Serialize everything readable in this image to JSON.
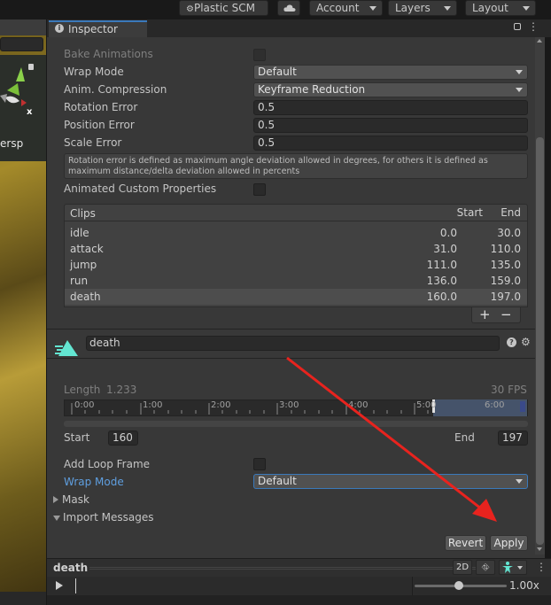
{
  "toolbar": {
    "plastic_scm": "Plastic SCM",
    "cloud_icon": "cloud-icon",
    "account": "Account",
    "layers": "Layers",
    "layout": "Layout"
  },
  "scene": {
    "persp": "ersp",
    "axis_x": "x"
  },
  "inspector": {
    "tab_label": "Inspector",
    "bake_animations": "Bake Animations",
    "wrap_mode_label": "Wrap Mode",
    "wrap_mode_value": "Default",
    "anim_compression_label": "Anim. Compression",
    "anim_compression_value": "Keyframe Reduction",
    "rotation_error_label": "Rotation Error",
    "rotation_error_value": "0.5",
    "position_error_label": "Position Error",
    "position_error_value": "0.5",
    "scale_error_label": "Scale Error",
    "scale_error_value": "0.5",
    "help_text": "Rotation error is defined as maximum angle deviation allowed in degrees, for others it is defined as maximum distance/delta deviation allowed in percents",
    "animated_custom_props": "Animated Custom Properties"
  },
  "clips": {
    "header": "Clips",
    "start_header": "Start",
    "end_header": "End",
    "rows": [
      {
        "name": "idle",
        "start": "0.0",
        "end": "30.0"
      },
      {
        "name": "attack",
        "start": "31.0",
        "end": "110.0"
      },
      {
        "name": "jump",
        "start": "111.0",
        "end": "135.0"
      },
      {
        "name": "run",
        "start": "136.0",
        "end": "159.0"
      },
      {
        "name": "death",
        "start": "160.0",
        "end": "197.0"
      }
    ],
    "add": "+",
    "remove": "−"
  },
  "clip_detail": {
    "name": "death",
    "length_label": "Length",
    "length_value": "1.233",
    "fps": "30 FPS",
    "ticks": [
      "0:00",
      "1:00",
      "2:00",
      "3:00",
      "4:00",
      "5:00",
      "6:00"
    ],
    "start_label": "Start",
    "start_value": "160",
    "end_label": "End",
    "end_value": "197",
    "add_loop_frame": "Add Loop Frame",
    "wrap_mode_label": "Wrap Mode",
    "wrap_mode_value": "Default",
    "mask": "Mask",
    "import_messages": "Import Messages",
    "revert": "Revert",
    "apply": "Apply"
  },
  "preview": {
    "clip_name": "death",
    "mode_2d": "2D",
    "speed": "1.00x"
  },
  "colors": {
    "accent": "#3a79bb",
    "arrow": "#e8231e",
    "teal": "#63e6d2"
  }
}
